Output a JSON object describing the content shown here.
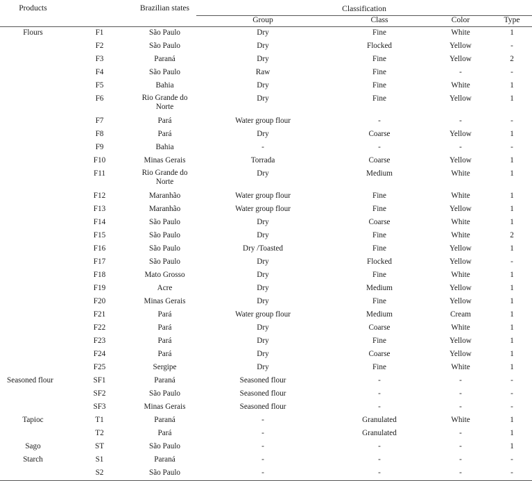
{
  "table": {
    "headers": {
      "products": "Products",
      "code": "",
      "states": "Brazilian states",
      "classification": "Classification",
      "group": "Group",
      "class": "Class",
      "color": "Color",
      "type": "Type"
    },
    "empty_marker": "-",
    "rows": [
      {
        "product": "Flours",
        "code": "F1",
        "state": "São Paulo",
        "group": "Dry",
        "class": "Fine",
        "color": "White",
        "type": "1"
      },
      {
        "product": "",
        "code": "F2",
        "state": "São Paulo",
        "group": "Dry",
        "class": "Flocked",
        "color": "Yellow",
        "type": "-"
      },
      {
        "product": "",
        "code": "F3",
        "state": "Paraná",
        "group": "Dry",
        "class": "Fine",
        "color": "Yellow",
        "type": "2"
      },
      {
        "product": "",
        "code": "F4",
        "state": "São Paulo",
        "group": "Raw",
        "class": "Fine",
        "color": "-",
        "type": "-"
      },
      {
        "product": "",
        "code": "F5",
        "state": "Bahia",
        "group": "Dry",
        "class": "Fine",
        "color": "White",
        "type": "1"
      },
      {
        "product": "",
        "code": "F6",
        "state": "Rio Grande do Norte",
        "state_line1": "Rio Grande do",
        "state_line2": "Norte",
        "group": "Dry",
        "class": "Fine",
        "color": "Yellow",
        "type": "1",
        "tall": true
      },
      {
        "product": "",
        "code": "F7",
        "state": "Pará",
        "group": "Water group flour",
        "class": "-",
        "color": "-",
        "type": "-"
      },
      {
        "product": "",
        "code": "F8",
        "state": "Pará",
        "group": "Dry",
        "class": "Coarse",
        "color": "Yellow",
        "type": "1"
      },
      {
        "product": "",
        "code": "F9",
        "state": "Bahia",
        "group": "-",
        "class": "-",
        "color": "-",
        "type": "-"
      },
      {
        "product": "",
        "code": "F10",
        "state": "Minas Gerais",
        "group": "Torrada",
        "class": "Coarse",
        "color": "Yellow",
        "type": "1"
      },
      {
        "product": "",
        "code": "F11",
        "state": "Rio Grande do Norte",
        "state_line1": "Rio Grande do",
        "state_line2": "Norte",
        "group": "Dry",
        "class": "Medium",
        "color": "White",
        "type": "1",
        "tall": true
      },
      {
        "product": "",
        "code": "F12",
        "state": "Maranhão",
        "group": "Water group flour",
        "class": "Fine",
        "color": "White",
        "type": "1"
      },
      {
        "product": "",
        "code": "F13",
        "state": "Maranhão",
        "group": "Water group flour",
        "class": "Fine",
        "color": "Yellow",
        "type": "1"
      },
      {
        "product": "",
        "code": "F14",
        "state": "São Paulo",
        "group": "Dry",
        "class": "Coarse",
        "color": "White",
        "type": "1"
      },
      {
        "product": "",
        "code": "F15",
        "state": "São Paulo",
        "group": "Dry",
        "class": "Fine",
        "color": "White",
        "type": "2"
      },
      {
        "product": "",
        "code": "F16",
        "state": "São Paulo",
        "group": "Dry /Toasted",
        "class": "Fine",
        "color": "Yellow",
        "type": "1"
      },
      {
        "product": "",
        "code": "F17",
        "state": "São Paulo",
        "group": "Dry",
        "class": "Flocked",
        "color": "Yellow",
        "type": "-"
      },
      {
        "product": "",
        "code": "F18",
        "state": "Mato Grosso",
        "group": "Dry",
        "class": "Fine",
        "color": "White",
        "type": "1"
      },
      {
        "product": "",
        "code": "F19",
        "state": "Acre",
        "group": "Dry",
        "class": "Medium",
        "color": "Yellow",
        "type": "1"
      },
      {
        "product": "",
        "code": "F20",
        "state": "Minas Gerais",
        "group": "Dry",
        "class": "Fine",
        "color": "Yellow",
        "type": "1"
      },
      {
        "product": "",
        "code": "F21",
        "state": "Pará",
        "group": "Water group flour",
        "class": "Medium",
        "color": "Cream",
        "type": "1"
      },
      {
        "product": "",
        "code": "F22",
        "state": "Pará",
        "group": "Dry",
        "class": "Coarse",
        "color": "White",
        "type": "1"
      },
      {
        "product": "",
        "code": "F23",
        "state": "Pará",
        "group": "Dry",
        "class": "Fine",
        "color": "Yellow",
        "type": "1"
      },
      {
        "product": "",
        "code": "F24",
        "state": "Pará",
        "group": "Dry",
        "class": "Coarse",
        "color": "Yellow",
        "type": "1"
      },
      {
        "product": "",
        "code": "F25",
        "state": "Sergipe",
        "group": "Dry",
        "class": "Fine",
        "color": "White",
        "type": "1"
      },
      {
        "product": "Seasoned flour",
        "code": "SF1",
        "state": "Paraná",
        "group": "Seasoned flour",
        "class": "-",
        "color": "-",
        "type": "-",
        "product_left": true
      },
      {
        "product": "",
        "code": "SF2",
        "state": "São Paulo",
        "group": "Seasoned flour",
        "class": "-",
        "color": "-",
        "type": "-"
      },
      {
        "product": "",
        "code": "SF3",
        "state": "Minas Gerais",
        "group": "Seasoned flour",
        "class": "-",
        "color": "-",
        "type": "-"
      },
      {
        "product": "Tapioc",
        "code": "T1",
        "state": "Paraná",
        "group": "-",
        "class": "Granulated",
        "color": "White",
        "type": "1"
      },
      {
        "product": "",
        "code": "T2",
        "state": "Pará",
        "group": "-",
        "class": "Granulated",
        "color": "-",
        "type": "1"
      },
      {
        "product": "Sago",
        "code": "ST",
        "state": "São Paulo",
        "group": "-",
        "class": "-",
        "color": "-",
        "type": "1"
      },
      {
        "product": "Starch",
        "code": "S1",
        "state": "Paraná",
        "group": "-",
        "class": "-",
        "color": "-",
        "type": "-"
      },
      {
        "product": "",
        "code": "S2",
        "state": "São Paulo",
        "group": "-",
        "class": "-",
        "color": "-",
        "type": "-"
      }
    ]
  }
}
